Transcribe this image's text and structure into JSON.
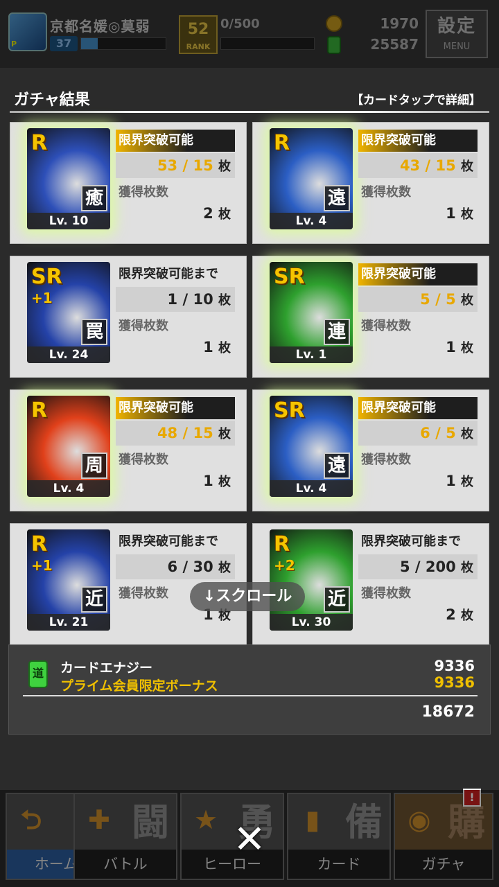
{
  "header": {
    "player_name": "京都名媛◎莫弱",
    "player_badge": "P",
    "player_level": "37",
    "rank_value": "52",
    "rank_label": "RANK",
    "rank_progress": "0/500",
    "coins": "1970",
    "energy": "25587",
    "menu_kanji": "設定",
    "menu_label": "MENU"
  },
  "panel": {
    "title": "ガチャ結果",
    "hint": "【カードタップで詳細】"
  },
  "cards": [
    {
      "rarity": "R",
      "plus": "",
      "kind": "癒",
      "level": "Lv. 10",
      "status": "限界突破可能",
      "count": "53 / 15",
      "unit": "枚",
      "owned_label": "獲得枚数",
      "owned": "2",
      "owned_unit": "枚",
      "colors": {
        "bg": "#2d4fb8"
      }
    },
    {
      "rarity": "R",
      "plus": "",
      "kind": "遠",
      "level": "Lv. 4",
      "status": "限界突破可能",
      "count": "43 / 15",
      "unit": "枚",
      "owned_label": "獲得枚数",
      "owned": "1",
      "owned_unit": "枚",
      "colors": {
        "bg": "#2b5ec4"
      }
    },
    {
      "rarity": "SR",
      "plus": "+1",
      "kind": "罠",
      "level": "Lv. 24",
      "status": "限界突破可能まで",
      "count": "1 / 10",
      "unit": "枚",
      "owned_label": "獲得枚数",
      "owned": "1",
      "owned_unit": "枚",
      "colors": {
        "bg": "#2442a8"
      }
    },
    {
      "rarity": "SR",
      "plus": "",
      "kind": "連",
      "level": "Lv. 1",
      "status": "限界突破可能",
      "count": "5 / 5",
      "unit": "枚",
      "owned_label": "獲得枚数",
      "owned": "1",
      "owned_unit": "枚",
      "colors": {
        "bg": "#2ea02e"
      }
    },
    {
      "rarity": "R",
      "plus": "",
      "kind": "周",
      "level": "Lv. 4",
      "status": "限界突破可能",
      "count": "48 / 15",
      "unit": "枚",
      "owned_label": "獲得枚数",
      "owned": "1",
      "owned_unit": "枚",
      "colors": {
        "bg": "#e0401a"
      }
    },
    {
      "rarity": "SR",
      "plus": "",
      "kind": "遠",
      "level": "Lv. 4",
      "status": "限界突破可能",
      "count": "6 / 5",
      "unit": "枚",
      "owned_label": "獲得枚数",
      "owned": "1",
      "owned_unit": "枚",
      "colors": {
        "bg": "#2b5ec4"
      }
    },
    {
      "rarity": "R",
      "plus": "+1",
      "kind": "近",
      "level": "Lv. 21",
      "status": "限界突破可能まで",
      "count": "6 / 30",
      "unit": "枚",
      "owned_label": "獲得枚数",
      "owned": "1",
      "owned_unit": "枚",
      "colors": {
        "bg": "#2442a8"
      }
    },
    {
      "rarity": "R",
      "plus": "+2",
      "kind": "近",
      "level": "Lv. 30",
      "status": "限界突破可能まで",
      "count": "5 / 200",
      "unit": "枚",
      "owned_label": "獲得枚数",
      "owned": "2",
      "owned_unit": "枚",
      "colors": {
        "bg": "#2ea02e"
      }
    }
  ],
  "scroll_hint": "↓スクロール",
  "energy_summary": {
    "icon_text": "道",
    "label": "カードエナジー",
    "bonus_label": "プライム会員限定ボーナス",
    "amount": "9336",
    "bonus_amount": "9336",
    "total": "18672"
  },
  "nav": {
    "home": {
      "label": "ホーム",
      "kanji": ""
    },
    "battle": {
      "label": "バトル",
      "kanji": "闘"
    },
    "hero": {
      "label": "ヒーロー",
      "kanji": "勇"
    },
    "card": {
      "label": "カード",
      "kanji": "備"
    },
    "gacha": {
      "label": "ガチャ",
      "kanji": "購"
    },
    "badge": "!"
  },
  "close_symbol": "✕"
}
